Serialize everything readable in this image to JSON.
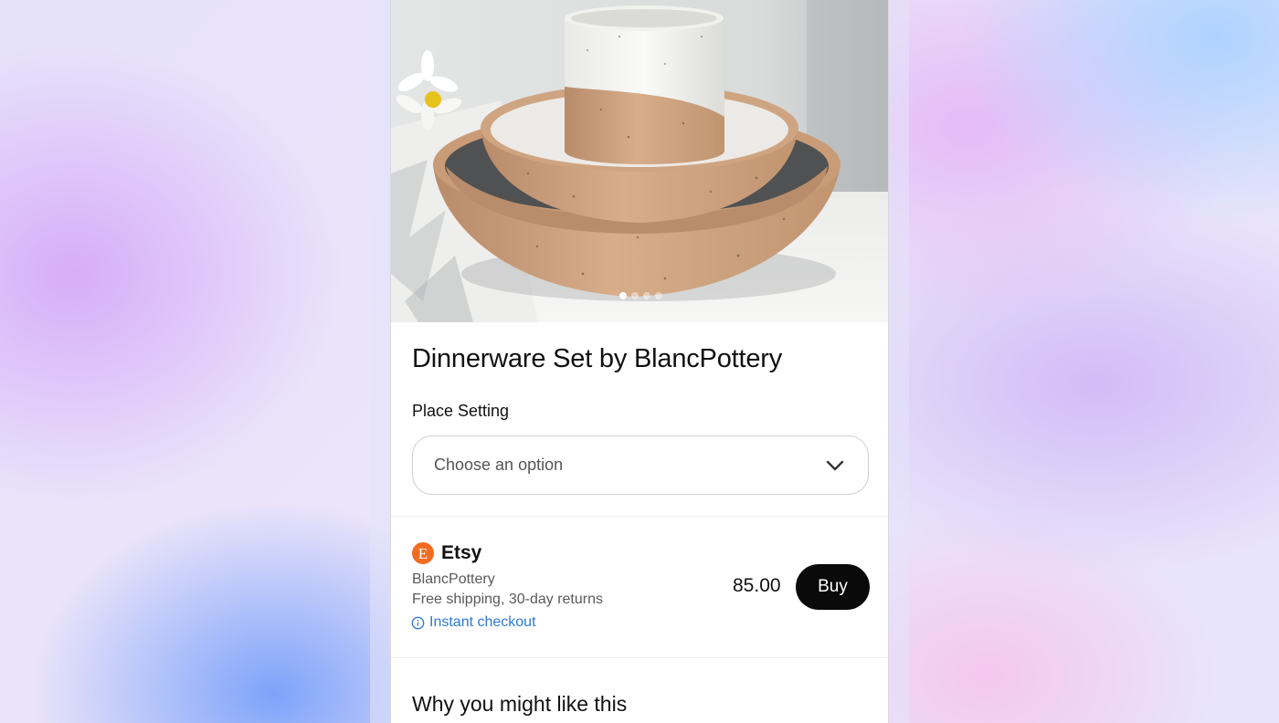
{
  "product": {
    "title": "Dinnerware Set by BlancPottery",
    "image": {
      "description_icon": "pottery-photo",
      "carousel_total": 4,
      "carousel_active_index": 1
    },
    "option": {
      "label": "Place Setting",
      "placeholder": "Choose an option"
    }
  },
  "offer": {
    "merchant_logo_letter": "E",
    "merchant_logo_icon": "etsy-logo-icon",
    "merchant": "Etsy",
    "seller": "BlancPottery",
    "shipping": "Free shipping, 30-day returns",
    "checkout": "Instant checkout",
    "price": "85.00",
    "buy_label": "Buy"
  },
  "section": {
    "why_title": "Why you might like this"
  },
  "colors": {
    "etsy_orange": "#f26c21",
    "link_blue": "#2c7ad6",
    "buy_button": "#0a0a0a"
  }
}
